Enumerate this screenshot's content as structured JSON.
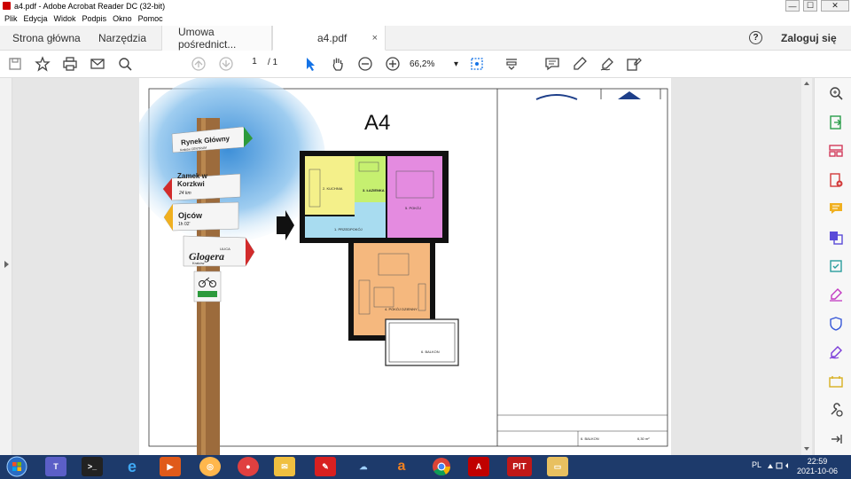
{
  "window": {
    "title": "a4.pdf - Adobe Acrobat Reader DC (32-bit)",
    "controls": {
      "minimize": "—",
      "maximize": "☐",
      "close": "✕"
    }
  },
  "menu": [
    "Plik",
    "Edycja",
    "Widok",
    "Podpis",
    "Okno",
    "Pomoc"
  ],
  "tabs": {
    "home": "Strona główna",
    "tools": "Narzędzia",
    "doc1": "Umowa pośrednict...",
    "doc2": "a4.pdf",
    "close_glyph": "×"
  },
  "header": {
    "help": "?",
    "login": "Zaloguj się"
  },
  "toolbar": {
    "page_current": "1",
    "page_total": "/ 1",
    "zoom": "66,2%",
    "zoom_caret": "▾"
  },
  "plan": {
    "title": "A4",
    "rooms": [
      "1. PRZEDPOKÓJ",
      "2. KUCHNIA",
      "3. ŁAZIENKA",
      "5. POKÓJ",
      "4. POKÓJ DZIENNY",
      "6. BALKON"
    ],
    "legend_row": {
      "name": "6. BALKON",
      "area": "6,30 m²"
    }
  },
  "signpost": {
    "signs": [
      "Rynek Główny",
      "Zamek w Korzkwi",
      "Ojców",
      "Glogera"
    ],
    "sub": [
      "Kraków CENTRUM",
      "24 km",
      "1h 02'",
      "Kraków",
      "ULICA"
    ]
  },
  "tray": {
    "lang": "PL",
    "time": "22:59",
    "date": "2021-10-06"
  },
  "taskbar": {
    "pit": "PIT"
  },
  "colors": {
    "kitchen": "#f4f08a",
    "bath": "#c6f070",
    "room5": "#e48be0",
    "hall": "#a8dcf0",
    "living": "#f5b87e",
    "taskbar": "#1d3a6b"
  }
}
